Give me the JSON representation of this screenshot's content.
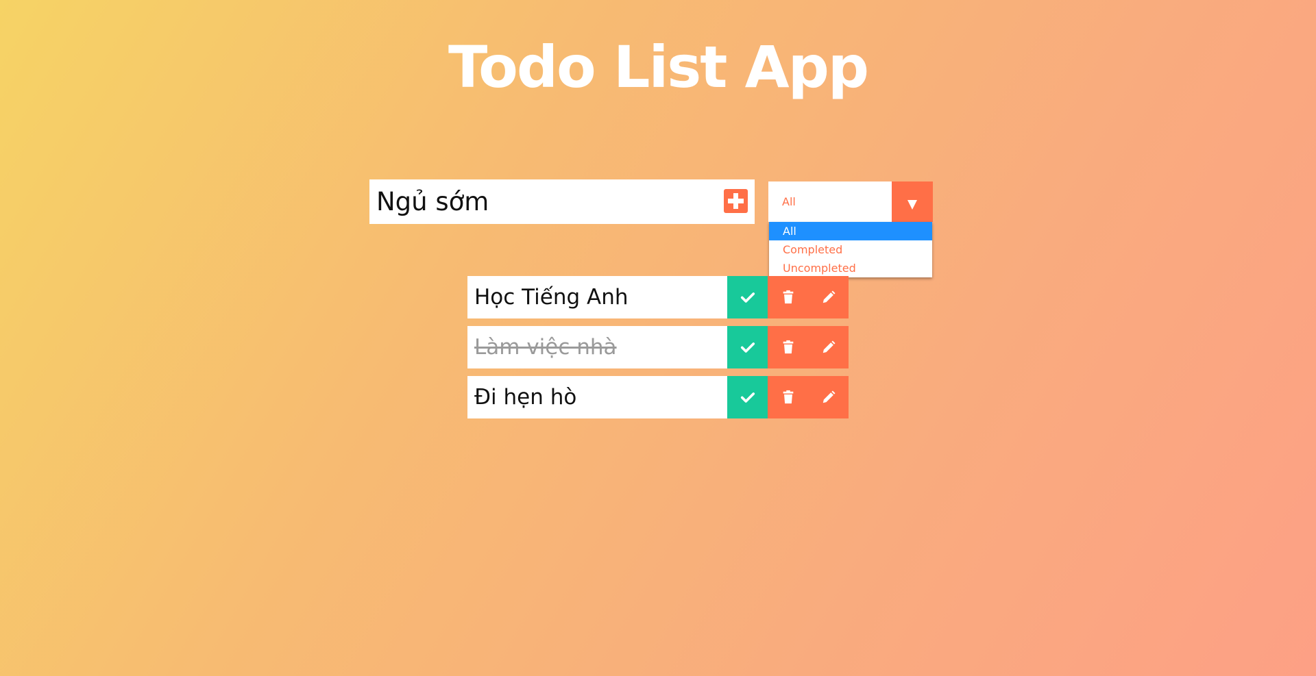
{
  "app": {
    "title": "Todo List App"
  },
  "add_form": {
    "input_value": "Ngủ sớm",
    "add_icon": "plus-square-icon"
  },
  "filter": {
    "selected": "All",
    "arrow_icon": "caret-down-icon",
    "options": [
      "All",
      "Completed",
      "Uncompleted"
    ],
    "highlighted_option": "All"
  },
  "todos": [
    {
      "text": "Học Tiếng Anh",
      "completed": false
    },
    {
      "text": "Làm việc nhà",
      "completed": true
    },
    {
      "text": "Đi hẹn hò",
      "completed": false
    }
  ],
  "icons": {
    "complete": "check-icon",
    "delete": "trash-icon",
    "edit": "pencil-icon"
  },
  "colors": {
    "accent": "#ff6f47",
    "complete": "#18c99a",
    "highlight": "#1e90ff",
    "gradient_start": "#f6d365",
    "gradient_end": "#fda085"
  }
}
